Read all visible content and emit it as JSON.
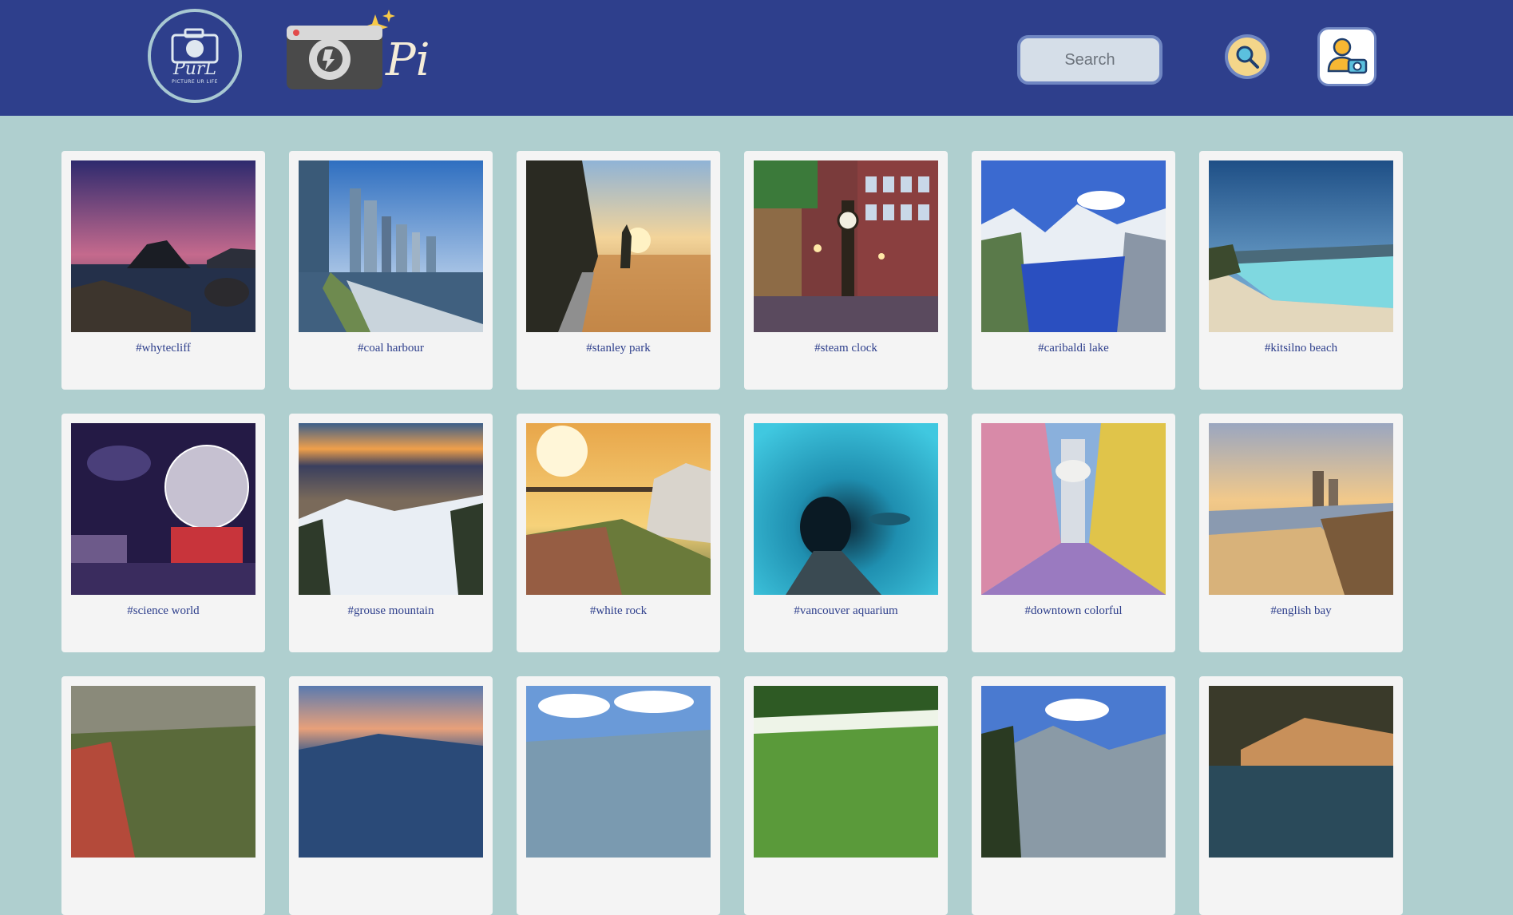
{
  "header": {
    "brand_name": "PurL",
    "brand_tagline": "PICTURE UR LIFE",
    "camera_logo_text": "Pi",
    "search_placeholder": "Search",
    "search_icon": "magnifier-icon",
    "profile_icon": "user-camera-icon"
  },
  "colors": {
    "header_bg": "#2e3f8c",
    "page_bg": "#afcfcf",
    "card_bg": "#f4f4f4",
    "tag_text": "#2e3f8c",
    "search_button": "#f4d68a"
  },
  "gallery": {
    "rows": [
      [
        "#whytecliff",
        "#coal harbour",
        "#stanley park",
        "#steam clock",
        "#caribaldi lake",
        "#kitsilno beach"
      ],
      [
        "#science world",
        "#grouse mountain",
        "#white rock",
        "#vancouver aquarium",
        "#downtown colorful",
        "#english bay"
      ],
      [
        "",
        "",
        "",
        "",
        "",
        ""
      ]
    ]
  }
}
